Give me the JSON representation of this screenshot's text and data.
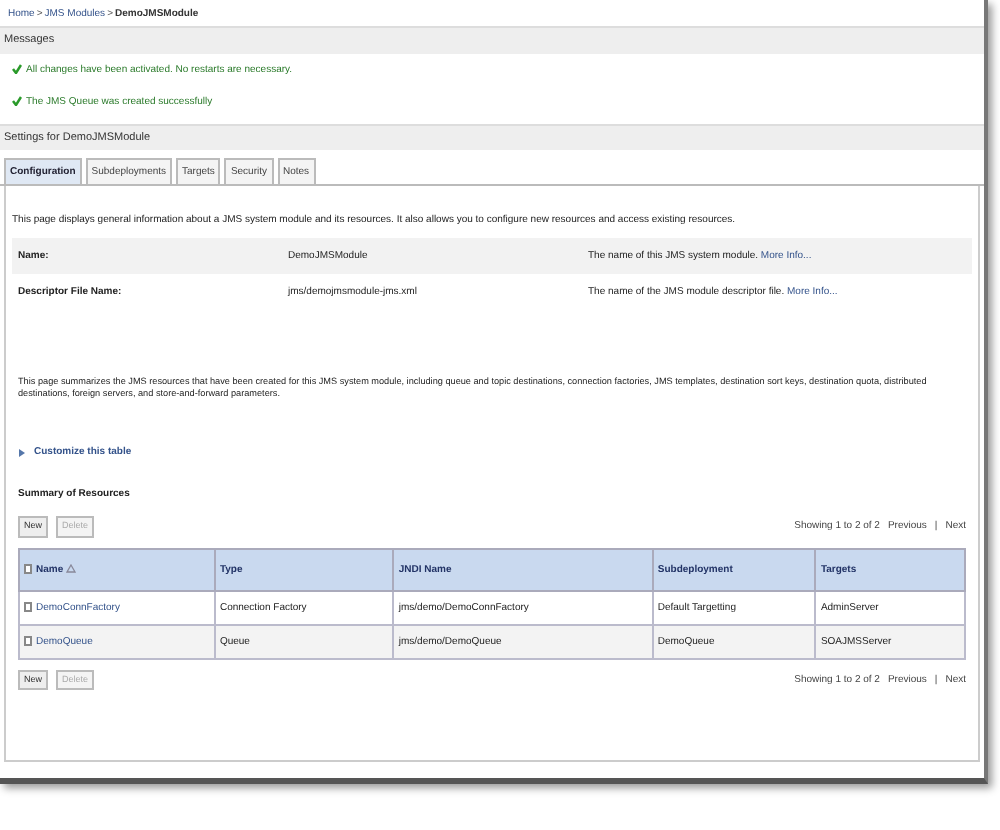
{
  "breadcrumb": [
    {
      "label": "Home",
      "current": false
    },
    {
      "label": ">",
      "kind": "separator"
    },
    {
      "label": "JMS Modules",
      "current": false
    },
    {
      "label": ">",
      "kind": "separator"
    },
    {
      "label": "DemoJMSModule",
      "current": true
    }
  ],
  "messages": {
    "title": "Messages",
    "items": [
      "All changes have been activated. No restarts are necessary.",
      "The JMS Queue was created successfully"
    ]
  },
  "settings_title": "Settings for DemoJMSModule",
  "tabs": [
    {
      "label": "Configuration",
      "selected": true
    },
    {
      "label": "Subdeployments",
      "selected": false
    },
    {
      "label": "Targets",
      "selected": false
    },
    {
      "label": "Security",
      "selected": false
    },
    {
      "label": "Notes",
      "selected": false
    }
  ],
  "intro": "This page displays general information about a JMS system module and its resources. It also allows you to configure new resources and access existing resources.",
  "fields": [
    {
      "label": "Name:",
      "value": "DemoJMSModule",
      "help": "The name of this JMS system module.",
      "link": "More Info..."
    },
    {
      "label": "Descriptor File Name:",
      "value": "jms/demojmsmodule-jms.xml",
      "help": "The name of the JMS module descriptor file.",
      "link": "More Info..."
    }
  ],
  "summary_text": "This page summarizes the JMS resources that have been created for this JMS system module, including queue and topic destinations, connection factories, JMS templates, destination sort keys, destination quota, distributed destinations, foreign servers, and store-and-forward parameters.",
  "customize_link": "Customize this table",
  "table": {
    "title": "Summary of Resources",
    "toolbars": [
      {
        "buttons": [
          {
            "label": "New",
            "disabled": false
          },
          {
            "label": "Delete",
            "disabled": true
          }
        ],
        "paging": {
          "text": "Showing 1 to 2 of 2",
          "previous": "Previous",
          "separator": "|",
          "next": "Next"
        }
      },
      {
        "buttons": [
          {
            "label": "New",
            "disabled": false
          },
          {
            "label": "Delete",
            "disabled": true
          }
        ],
        "paging": {
          "text": "Showing 1 to 2 of 2",
          "previous": "Previous",
          "separator": "|",
          "next": "Next"
        }
      }
    ],
    "all_checked": false,
    "columns": [
      {
        "label": "Name",
        "sorted": true
      },
      {
        "label": "Type",
        "sorted": false
      },
      {
        "label": "JNDI Name",
        "sorted": false
      },
      {
        "label": "Subdeployment",
        "sorted": false
      },
      {
        "label": "Targets",
        "sorted": false
      }
    ],
    "rows": [
      {
        "checked": false,
        "cells": [
          "DemoConnFactory",
          "Connection Factory",
          "jms/demo/DemoConnFactory",
          "Default Targetting",
          "AdminServer"
        ]
      },
      {
        "checked": false,
        "cells": [
          "DemoQueue",
          "Queue",
          "jms/demo/DemoQueue",
          "DemoQueue",
          "SOAJMSServer"
        ]
      }
    ]
  }
}
